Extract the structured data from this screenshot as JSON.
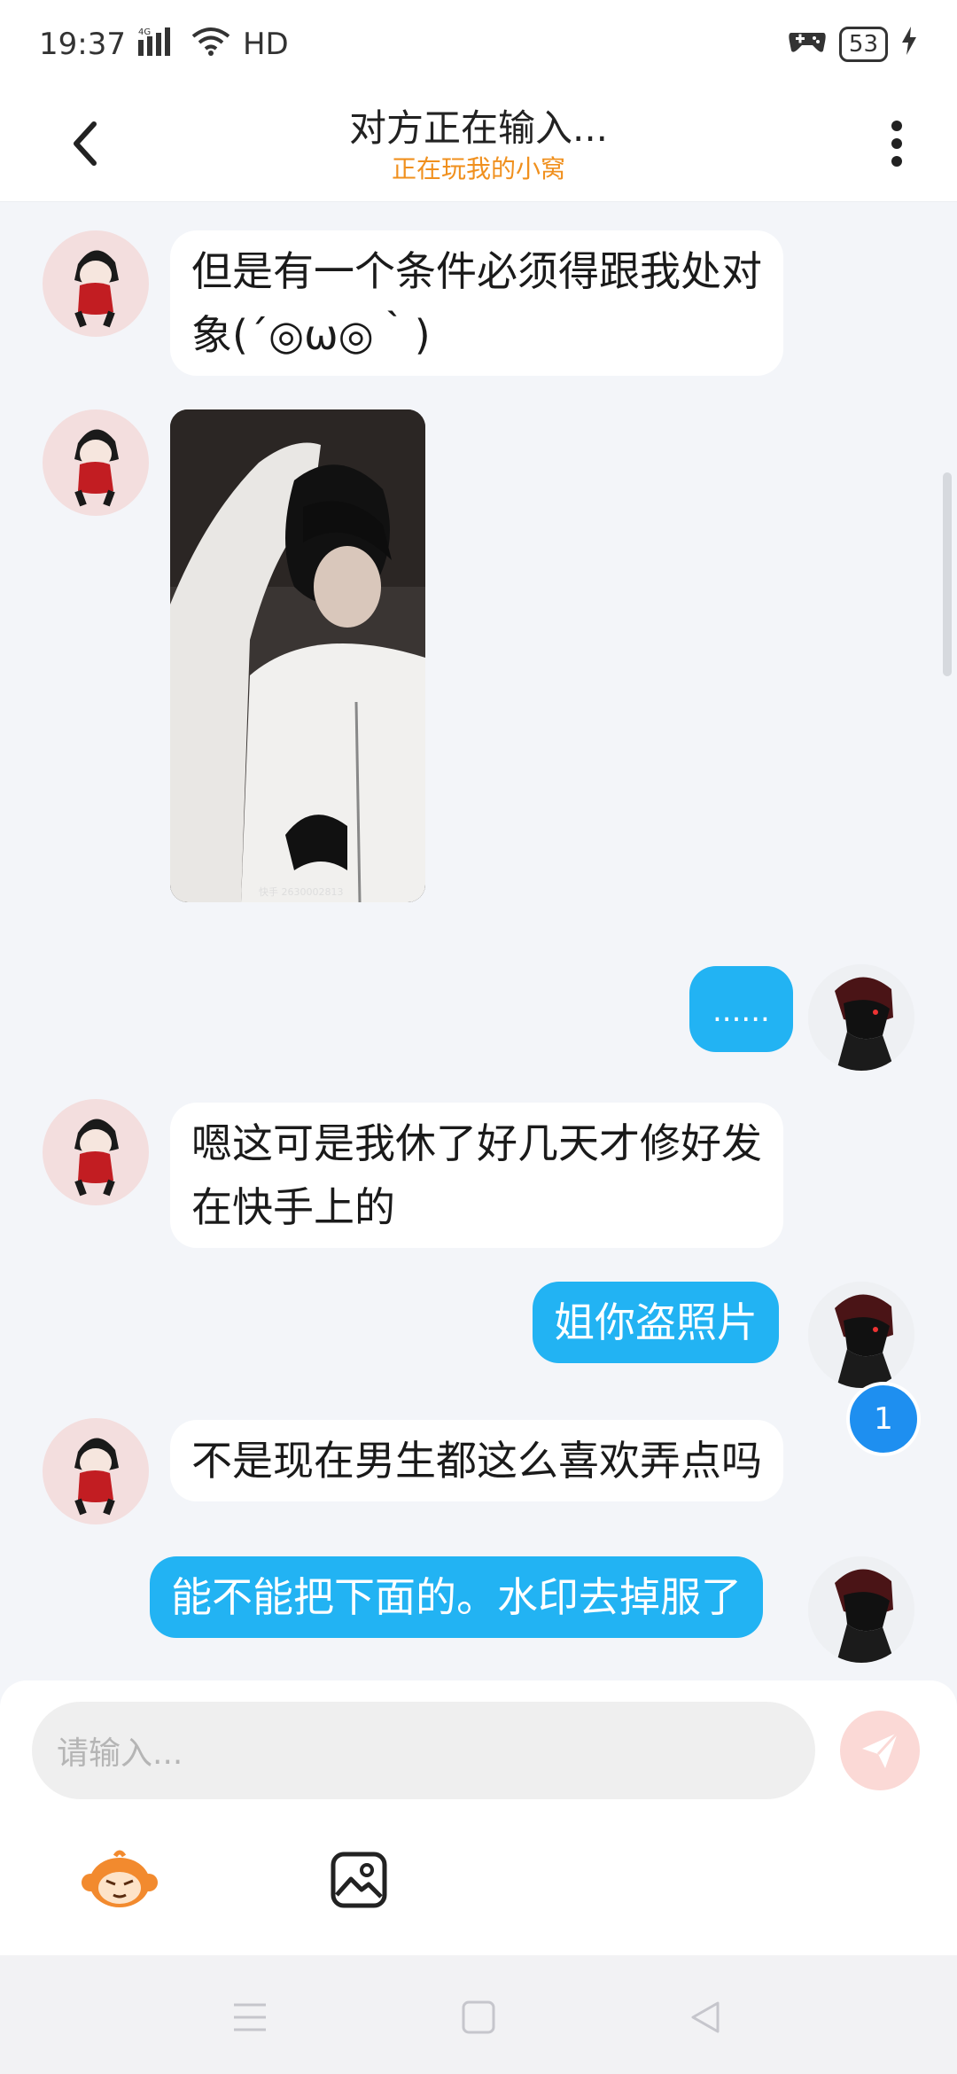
{
  "status_bar": {
    "time": "19:37",
    "network": "4G",
    "hd": "HD",
    "battery": "53"
  },
  "header": {
    "title": "对方正在输入...",
    "subtitle": "正在玩我的小窝"
  },
  "messages": [
    {
      "side": "left",
      "type": "text",
      "lines": [
        "但是有一个条件必须得跟我处对",
        "象(´◎ω◎｀)"
      ]
    },
    {
      "side": "left",
      "type": "image",
      "watermark": "快手 2630002813"
    },
    {
      "side": "right",
      "type": "text",
      "text": "......"
    },
    {
      "side": "left",
      "type": "text",
      "lines": [
        "嗯这可是我休了好几天才修好发",
        "在快手上的"
      ]
    },
    {
      "side": "right",
      "type": "text",
      "text": "姐你盗照片"
    },
    {
      "side": "left",
      "type": "text",
      "lines": [
        "不是现在男生都这么喜欢弄点吗"
      ]
    },
    {
      "side": "right",
      "type": "text",
      "text": "能不能把下面的。水印去掉服了"
    }
  ],
  "unread_badge": "1",
  "composer": {
    "placeholder": "请输入..."
  },
  "colors": {
    "bubble_right": "#22b3f3",
    "subtitle": "#f0901e",
    "badge": "#1e8ff0"
  },
  "icons": {
    "back": "chevron-left-icon",
    "more": "more-vertical-icon",
    "send": "paper-plane-icon",
    "emoji": "monkey-emoji-icon",
    "image": "image-icon"
  }
}
